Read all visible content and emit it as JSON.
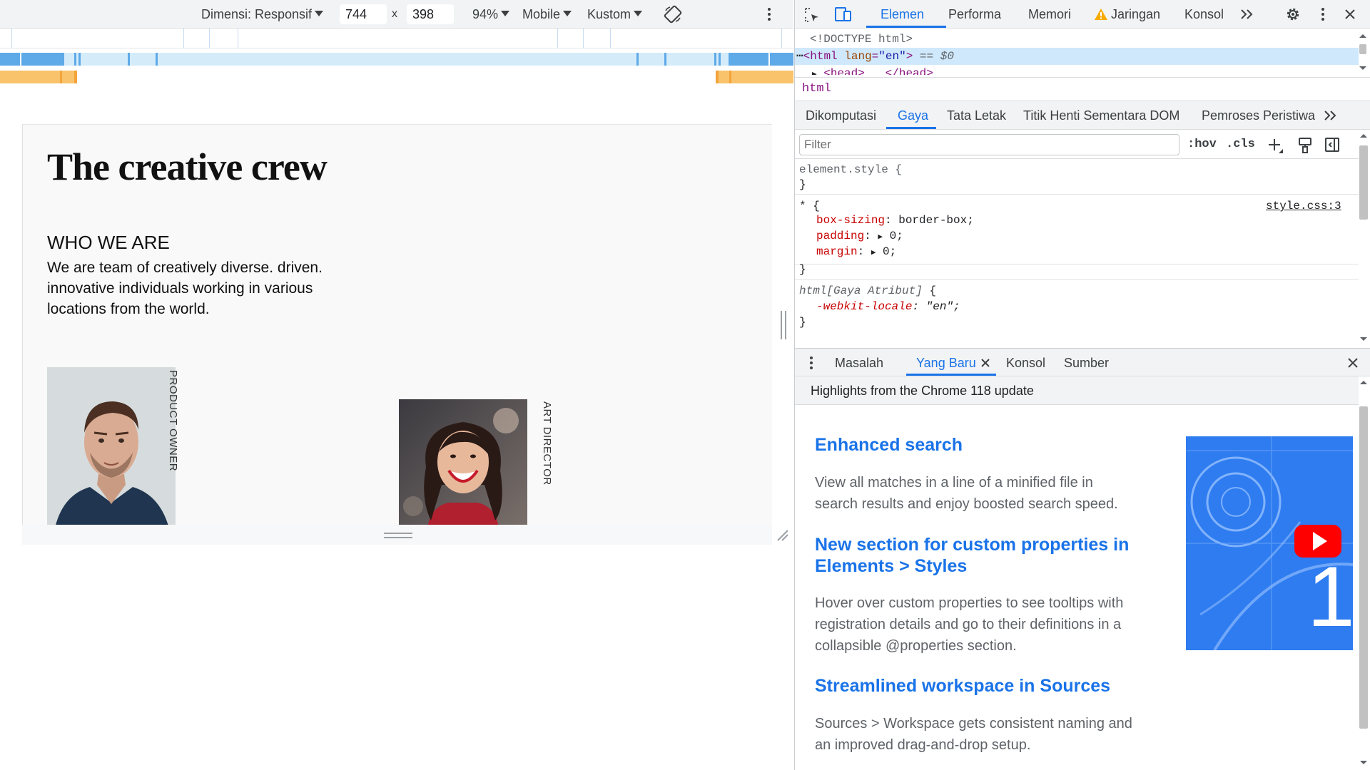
{
  "device_toolbar": {
    "dimension_label": "Dimensi: Responsif",
    "width": "744",
    "times": "x",
    "height": "398",
    "zoom": "94%",
    "device_type": "Mobile",
    "throttle": "Kustom"
  },
  "page": {
    "title": "The creative crew",
    "section_heading": "WHO WE ARE",
    "section_text": "We are team of creatively diverse. driven. innovative individuals working in various locations from the world.",
    "members": [
      {
        "role": "PRODUCT OWNER"
      },
      {
        "role": "ART DIRECTOR"
      }
    ]
  },
  "devtools": {
    "tabs": [
      "Elemen",
      "Performa",
      "Memori",
      "Jaringan",
      "Konsol"
    ],
    "active_tab": "Elemen",
    "dom": {
      "doctype": "<!DOCTYPE html>",
      "html_tag_open": "<html",
      "html_attr_name": "lang",
      "html_attr_value": "\"en\"",
      "html_tag_close": ">",
      "selected_marker": "== $0",
      "head_line": "<head> … </head>"
    },
    "breadcrumb": "html",
    "sub_tabs": [
      "Dikomputasi",
      "Gaya",
      "Tata Letak",
      "Titik Henti Sementara DOM",
      "Pemroses Peristiwa"
    ],
    "active_sub_tab": "Gaya",
    "filter_placeholder": "Filter",
    "hov_label": ":hov",
    "cls_label": ".cls",
    "styles": {
      "element_style_selector": "element.style {",
      "close_brace": "}",
      "universal_selector": "* {",
      "universal_source": "style.css:3",
      "decl1_prop": "box-sizing",
      "decl1_value": "border-box;",
      "decl2_prop": "padding",
      "decl2_value": "0;",
      "decl3_prop": "margin",
      "decl3_value": "0;",
      "html_selector": "html[Gaya Atribut]",
      "open_brace": "{",
      "decl4_prop": "-webkit-locale",
      "decl4_value": "\"en\";"
    },
    "drawer": {
      "tabs": [
        "Masalah",
        "Yang Baru",
        "Konsol",
        "Sumber"
      ],
      "active_tab": "Yang Baru",
      "subheader": "Highlights from the Chrome 118 update",
      "features": [
        {
          "title": "Enhanced search",
          "body": "View all matches in a line of a minified file in search results and enjoy boosted search speed."
        },
        {
          "title": "New section for custom properties in Elements > Styles",
          "body": "Hover over custom properties to see tooltips with registration details and go to their definitions in a collapsible @properties section."
        },
        {
          "title": "Streamlined workspace in Sources",
          "body": "Sources > Workspace gets consistent naming and an improved drag-and-drop setup."
        }
      ],
      "video_number": "1"
    }
  },
  "colors": {
    "accent": "#1a73e8",
    "warning": "#f9ab00",
    "toolbar_bg": "#f1f3f4",
    "youtube_red": "#ff0000"
  }
}
